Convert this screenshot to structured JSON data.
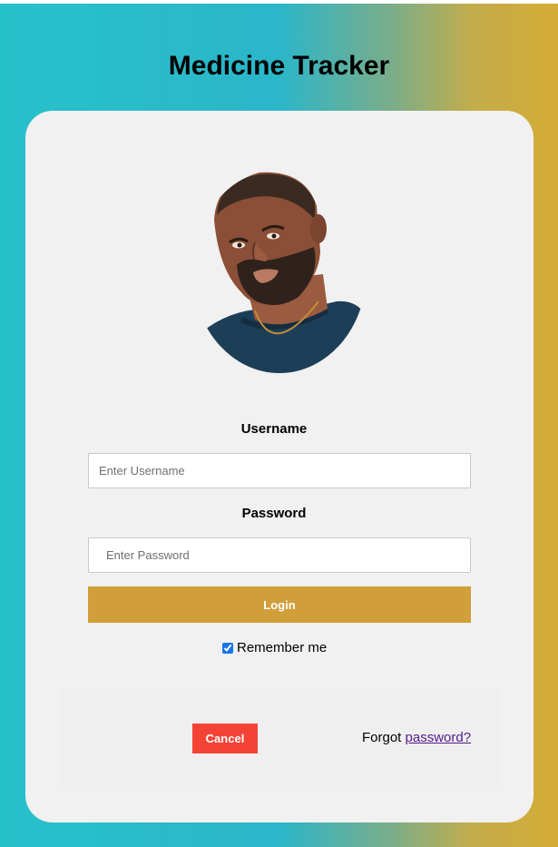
{
  "app": {
    "title": "Medicine Tracker"
  },
  "avatar": {
    "icon": "user-avatar-illustration"
  },
  "form": {
    "username_label": "Username",
    "username_placeholder": "Enter Username",
    "password_label": "Password",
    "password_placeholder": "Enter Password",
    "login_label": "Login",
    "remember_label": "Remember me",
    "remember_checked": true
  },
  "footer": {
    "cancel_label": "Cancel",
    "forgot_prefix": "Forgot",
    "forgot_link": "password?"
  },
  "colors": {
    "login_button": "#d09f3a",
    "cancel_button": "#f44336",
    "card_background": "#f1f1f1",
    "link": "#551a8b"
  }
}
